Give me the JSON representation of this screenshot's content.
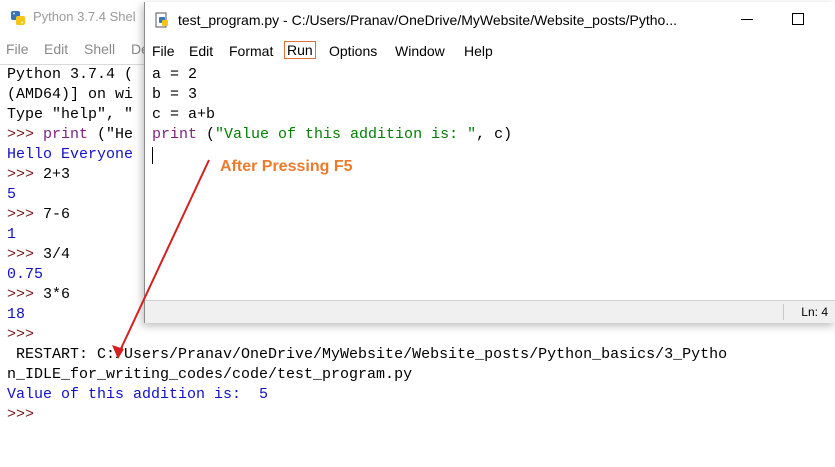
{
  "shell": {
    "title": "Python 3.7.4 Shel",
    "menu": [
      "File",
      "Edit",
      "Shell",
      "De"
    ],
    "lines": [
      {
        "parts": [
          {
            "t": "Python 3.7.4 (",
            "c": "black"
          }
        ]
      },
      {
        "parts": [
          {
            "t": "(AMD64)] on wi",
            "c": "black"
          }
        ]
      },
      {
        "parts": [
          {
            "t": "Type \"help\", \"",
            "c": "black"
          }
        ]
      },
      {
        "parts": [
          {
            "t": ">>> ",
            "c": "prompt"
          },
          {
            "t": "print",
            "c": "purple"
          },
          {
            "t": " (\"He",
            "c": "black"
          }
        ]
      },
      {
        "parts": [
          {
            "t": "Hello Everyone",
            "c": "blue"
          }
        ]
      },
      {
        "parts": [
          {
            "t": ">>> ",
            "c": "prompt"
          },
          {
            "t": "2+3",
            "c": "black"
          }
        ]
      },
      {
        "parts": [
          {
            "t": "5",
            "c": "blue"
          }
        ]
      },
      {
        "parts": [
          {
            "t": ">>> ",
            "c": "prompt"
          },
          {
            "t": "7-6",
            "c": "black"
          }
        ]
      },
      {
        "parts": [
          {
            "t": "1",
            "c": "blue"
          }
        ]
      },
      {
        "parts": [
          {
            "t": ">>> ",
            "c": "prompt"
          },
          {
            "t": "3/4",
            "c": "black"
          }
        ]
      },
      {
        "parts": [
          {
            "t": "0.75",
            "c": "blue"
          }
        ]
      },
      {
        "parts": [
          {
            "t": ">>> ",
            "c": "prompt"
          },
          {
            "t": "3*6",
            "c": "black"
          }
        ]
      },
      {
        "parts": [
          {
            "t": "18",
            "c": "blue"
          }
        ]
      },
      {
        "parts": [
          {
            "t": ">>>",
            "c": "prompt"
          }
        ]
      },
      {
        "parts": [
          {
            "t": " RESTART: C:/Users/Pranav/OneDrive/MyWebsite/Website_posts/Python_basics/3_Pytho",
            "c": "black"
          }
        ]
      },
      {
        "parts": [
          {
            "t": "n_IDLE_for_writing_codes/code/test_program.py",
            "c": "black"
          }
        ]
      },
      {
        "parts": [
          {
            "t": "Value of this addition is:  5",
            "c": "blue"
          }
        ]
      },
      {
        "parts": [
          {
            "t": ">>>",
            "c": "prompt"
          }
        ]
      }
    ]
  },
  "editor": {
    "title": "test_program.py - C:/Users/Pranav/OneDrive/MyWebsite/Website_posts/Pytho...",
    "menu": [
      "File",
      "Edit",
      "Format",
      "Run",
      "Options",
      "Window",
      "Help"
    ],
    "active_menu": "Run",
    "lines": [
      {
        "parts": [
          {
            "t": "a = 2",
            "c": "black"
          }
        ]
      },
      {
        "parts": [
          {
            "t": "b = 3",
            "c": "black"
          }
        ]
      },
      {
        "parts": [
          {
            "t": "c = a+b",
            "c": "black"
          }
        ]
      },
      {
        "parts": [
          {
            "t": "print",
            "c": "purple"
          },
          {
            "t": " (",
            "c": "black"
          },
          {
            "t": "\"Value of this addition is: \"",
            "c": "green"
          },
          {
            "t": ", c)",
            "c": "black"
          }
        ]
      }
    ],
    "status": "Ln: 4"
  },
  "annotation": {
    "label": "After Pressing F5",
    "color": "#ec7b2d",
    "arrow_color": "#d42020"
  },
  "colors": {
    "keyword": "#7f1f7f",
    "output": "#1010c8",
    "string": "#008000"
  }
}
